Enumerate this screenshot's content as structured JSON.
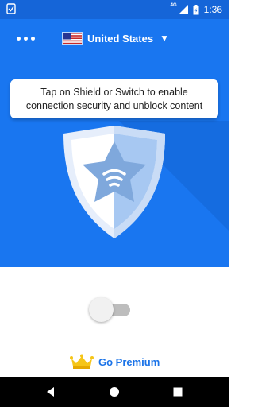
{
  "status_bar": {
    "network": "4G",
    "time": "1:36"
  },
  "header": {
    "menu_icon": "more-horizontal-icon",
    "country": "United States",
    "country_flag": "us-flag-icon",
    "dropdown_icon": "caret-down-icon"
  },
  "main": {
    "hint": "Tap on Shield or Switch to enable connection security and unblock content",
    "shield_icon": "shield-star-wifi-icon",
    "switch_on": false,
    "premium_icon": "crown-icon",
    "premium_label": "Go Premium"
  },
  "nav": {
    "back_icon": "back-triangle-icon",
    "home_icon": "home-circle-icon",
    "recents_icon": "recents-square-icon"
  },
  "colors": {
    "hero_blue": "#1976f0",
    "accent": "#1a73e8",
    "crown": "#f5c518"
  }
}
